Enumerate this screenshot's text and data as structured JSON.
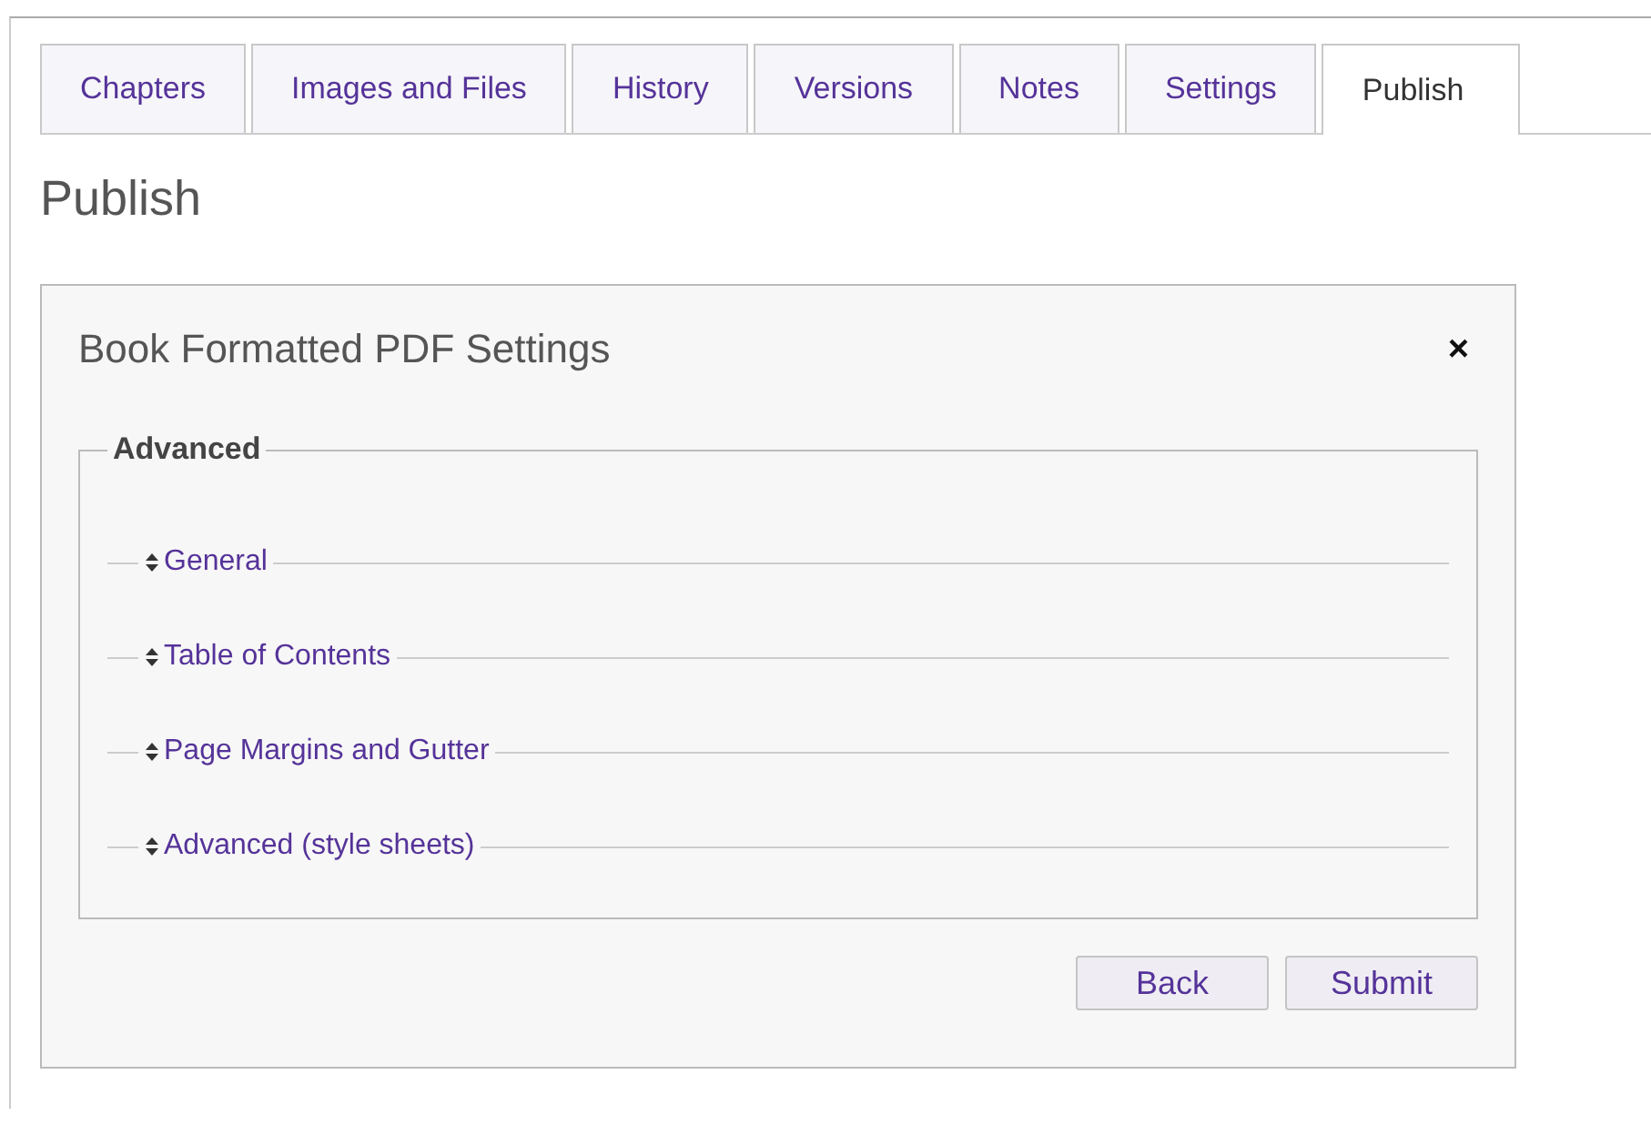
{
  "tabs": [
    {
      "label": "Chapters",
      "selected": false
    },
    {
      "label": "Images and Files",
      "selected": false
    },
    {
      "label": "History",
      "selected": false
    },
    {
      "label": "Versions",
      "selected": false
    },
    {
      "label": "Notes",
      "selected": false
    },
    {
      "label": "Settings",
      "selected": false
    },
    {
      "label": "Publish",
      "selected": true
    }
  ],
  "heading": "Publish",
  "dialog": {
    "title": "Book Formatted PDF Settings",
    "close": "×",
    "fieldset": {
      "legend": "Advanced",
      "sections": [
        {
          "label": "General"
        },
        {
          "label": "Table of Contents"
        },
        {
          "label": "Page Margins and Gutter"
        },
        {
          "label": "Advanced (style sheets)"
        }
      ]
    },
    "buttons": [
      "Back",
      "Submit"
    ]
  }
}
